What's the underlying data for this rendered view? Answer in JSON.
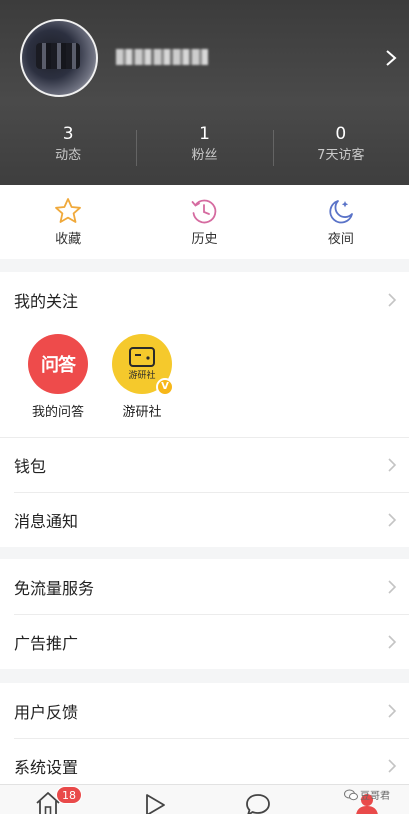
{
  "profile": {
    "stats": [
      {
        "num": "3",
        "label": "动态"
      },
      {
        "num": "1",
        "label": "粉丝"
      },
      {
        "num": "0",
        "label": "7天访客"
      }
    ]
  },
  "quick": [
    {
      "label": "收藏",
      "icon": "star-icon"
    },
    {
      "label": "历史",
      "icon": "history-icon"
    },
    {
      "label": "夜间",
      "icon": "night-mode-icon"
    }
  ],
  "follows": {
    "title": "我的关注",
    "items": [
      {
        "logo_text": "问答",
        "name": "我的问答"
      },
      {
        "logo_text": "游研社",
        "name": "游研社",
        "verified": "V"
      }
    ]
  },
  "menu": {
    "wallet": "钱包",
    "notifications": "消息通知",
    "data_free": "免流量服务",
    "ads": "广告推广",
    "feedback": "用户反馈",
    "settings": "系统设置"
  },
  "tabbar": {
    "home_badge": "18",
    "tabs": [
      "home-icon",
      "video-icon",
      "chat-icon",
      "profile-icon"
    ]
  },
  "watermark": {
    "text": "豆哥君"
  },
  "colors": {
    "accent_red": "#ee4b4b",
    "accent_yellow": "#f5c92c",
    "history_pink": "#d56ba0",
    "night_blue": "#5a73c8",
    "star_orange": "#f0a93b"
  }
}
